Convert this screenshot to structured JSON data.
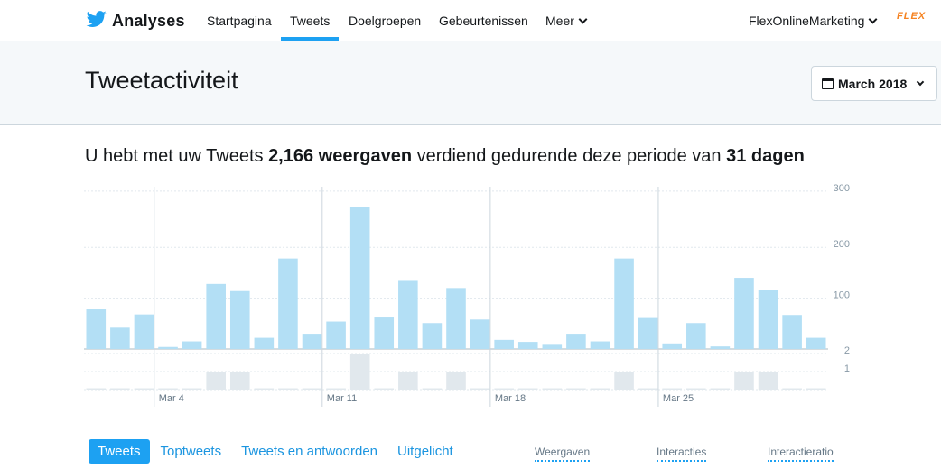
{
  "app": {
    "brand_label": "Analyses"
  },
  "nav": {
    "items": [
      {
        "label": "Startpagina"
      },
      {
        "label": "Tweets"
      },
      {
        "label": "Doelgroepen"
      },
      {
        "label": "Gebeurtenissen"
      },
      {
        "label": "Meer"
      }
    ],
    "active": "Tweets",
    "account_label": "FlexOnlineMarketing",
    "logo_text": "FLEX"
  },
  "header": {
    "title": "Tweetactiviteit",
    "date_button_label": "March 2018"
  },
  "summary": {
    "prefix": "U hebt met uw Tweets",
    "impressions": "2,166 weergaven",
    "middle": "verdiend gedurende deze periode van",
    "days": "31 dagen"
  },
  "chart_data": {
    "type": "bar",
    "x": [
      "Mar 1",
      "Mar 2",
      "Mar 3",
      "Mar 4",
      "Mar 5",
      "Mar 6",
      "Mar 7",
      "Mar 8",
      "Mar 9",
      "Mar 10",
      "Mar 11",
      "Mar 12",
      "Mar 13",
      "Mar 14",
      "Mar 15",
      "Mar 16",
      "Mar 17",
      "Mar 18",
      "Mar 19",
      "Mar 20",
      "Mar 21",
      "Mar 22",
      "Mar 23",
      "Mar 24",
      "Mar 25",
      "Mar 26",
      "Mar 27",
      "Mar 28",
      "Mar 29",
      "Mar 30",
      "Mar 31"
    ],
    "x_tick_labels": [
      "Mar 4",
      "Mar 11",
      "Mar 18",
      "Mar 25"
    ],
    "series": [
      {
        "values": [
          78,
          42,
          68,
          4,
          15,
          128,
          114,
          22,
          178,
          30,
          54,
          280,
          62,
          134,
          51,
          120,
          58,
          18,
          14,
          10,
          30,
          15,
          178,
          61,
          11,
          51,
          5,
          140,
          117,
          67,
          22
        ],
        "color": "#b3dff5"
      },
      {
        "values": [
          0,
          0,
          0,
          0,
          0,
          1,
          1,
          0,
          0,
          0,
          0,
          2,
          0,
          1,
          0,
          1,
          0,
          0,
          0,
          0,
          0,
          0,
          1,
          0,
          0,
          0,
          0,
          1,
          1,
          0,
          0
        ],
        "color": "#e1e8ed"
      }
    ],
    "impressions_ticks": [
      "100",
      "200",
      "300"
    ],
    "tweets_ticks": [
      "1",
      "2"
    ],
    "ylim": [
      0,
      300
    ],
    "ylim_tweets": [
      0,
      2
    ],
    "grid": true
  },
  "tabs": [
    {
      "label": "Tweets"
    },
    {
      "label": "Toptweets"
    },
    {
      "label": "Tweets en antwoorden"
    },
    {
      "label": "Uitgelicht"
    }
  ],
  "metrics": {
    "impressions_label": "Weergaven",
    "interactions_label": "Interacties",
    "rate_label": "Interactieratio"
  },
  "colors": {
    "accent": "#1da1f2",
    "bar": "#b3dff5",
    "tweet_bar": "#e1e8ed",
    "header_bg": "#f5f8fa"
  }
}
